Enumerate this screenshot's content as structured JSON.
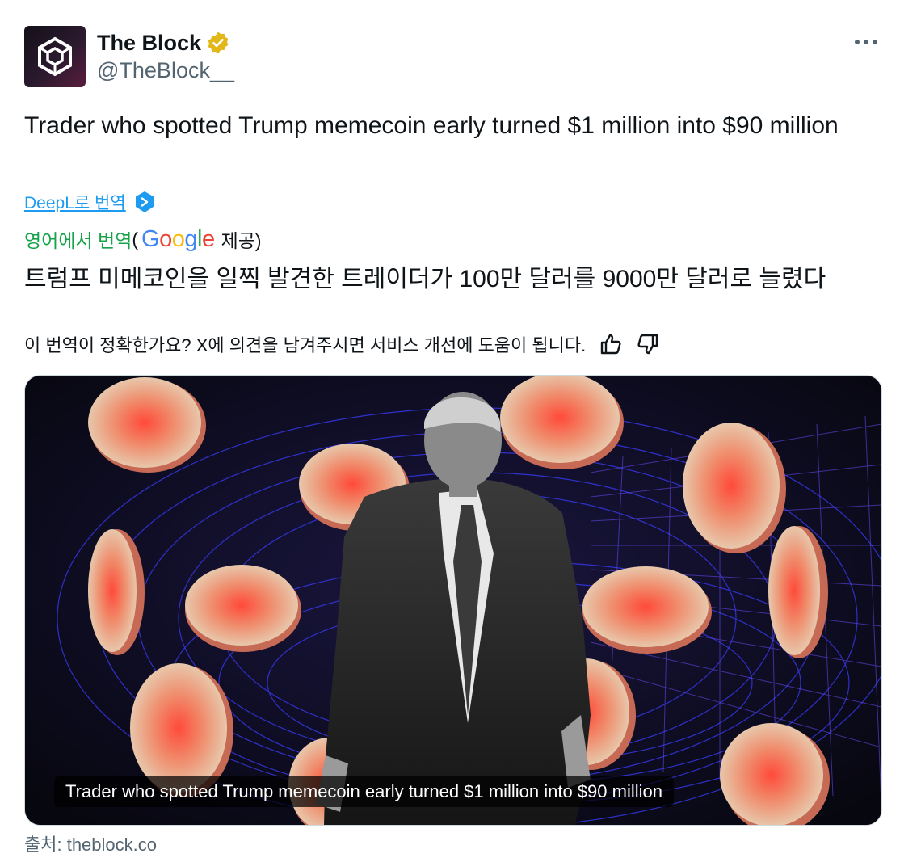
{
  "account": {
    "display_name": "The Block",
    "handle": "@TheBlock__",
    "avatar_icon": "the-block-cube-logo",
    "verified_color": "#e2b719"
  },
  "tweet": {
    "text": "Trader who spotted Trump memecoin early turned $1 million into $90 million"
  },
  "deepl": {
    "link_label": "DeepL로 번역",
    "icon": "deepl-icon"
  },
  "google_translation": {
    "translated_from": "영어에서 번역",
    "open_paren": "(",
    "google_letters": [
      "G",
      "o",
      "o",
      "g",
      "l",
      "e"
    ],
    "provided": "제공)",
    "text": "트럼프 미메코인을 일찍 발견한 트레이더가 100만 달러를 9000만 달러로 늘렸다"
  },
  "feedback": {
    "question": "이 번역이 정확한가요? X에 의견을 남겨주시면 서비스 개선에 도움이 됩니다."
  },
  "media": {
    "caption": "Trader who spotted Trump memecoin early turned $1 million into $90 million"
  },
  "source": {
    "label": "출처: theblock.co"
  },
  "colors": {
    "link": "#1d9bf0",
    "translated_from": "#17a34a",
    "secondary_text": "#536471",
    "coin_red": "#ff3b2f",
    "coin_cream": "#e6d3b8",
    "background_dark": "#0b0b1a",
    "grid_blue": "#3a3cff"
  }
}
